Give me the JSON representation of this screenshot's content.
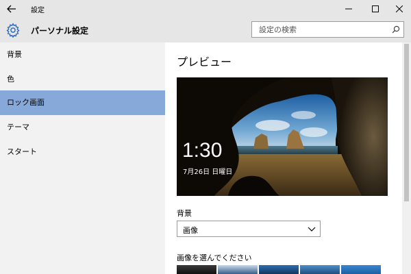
{
  "window": {
    "title": "設定",
    "controls": {
      "minimize_icon": "minimize-icon",
      "maximize_icon": "maximize-icon",
      "close_icon": "close-icon"
    },
    "back_icon": "back-arrow-icon"
  },
  "header": {
    "icon": "gear-icon",
    "title": "パーソナル設定",
    "search": {
      "placeholder": "設定の検索",
      "value": "",
      "icon": "search-icon"
    }
  },
  "sidebar": {
    "items": [
      {
        "label": "背景",
        "active": false
      },
      {
        "label": "色",
        "active": false
      },
      {
        "label": "ロック画面",
        "active": true
      },
      {
        "label": "テーマ",
        "active": false
      },
      {
        "label": "スタート",
        "active": false
      }
    ]
  },
  "main": {
    "preview_heading": "プレビュー",
    "preview": {
      "time": "1:30",
      "date": "7月26日 日曜日"
    },
    "background": {
      "label": "背景",
      "selected": "画像",
      "chevron_icon": "chevron-down-icon"
    },
    "choose_picture_label": "画像を選んでください",
    "thumbnail_count": 5
  },
  "colors": {
    "titlebar_bg": "#e6e6e6",
    "sidebar_bg": "#f2f2f2",
    "active_item_bg": "#87a9d9",
    "accent_icon": "#2e6cc2"
  }
}
